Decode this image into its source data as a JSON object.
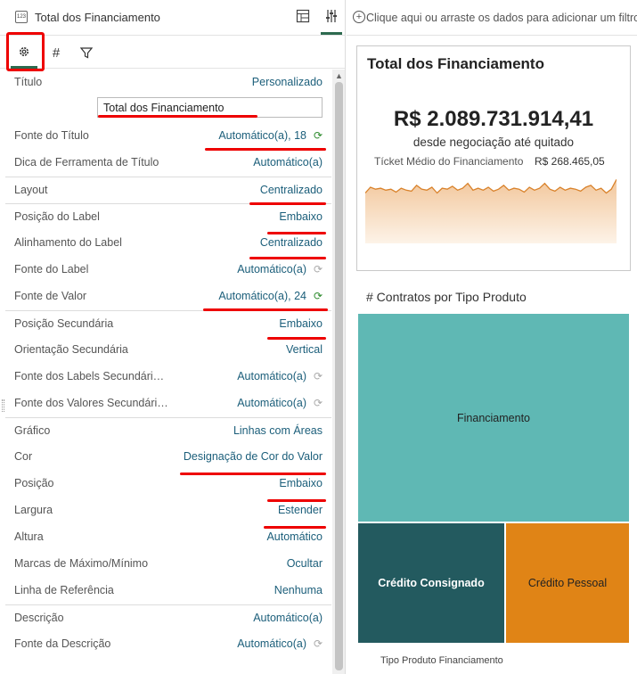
{
  "panel": {
    "title": "Total dos Financiamento",
    "viz_icon_text": "123",
    "tabs": {
      "general": "⚙",
      "values": "#",
      "filter": "⛛"
    }
  },
  "properties": [
    {
      "label": "Título",
      "value": "Personalizado"
    },
    {
      "label": "Fonte do Título",
      "value": "Automático(a), 18"
    },
    {
      "label": "Dica de Ferramenta de Título",
      "value": "Automático(a)"
    },
    {
      "label": "Layout",
      "value": "Centralizado"
    },
    {
      "label": "Posição do Label",
      "value": "Embaixo"
    },
    {
      "label": "Alinhamento do Label",
      "value": "Centralizado"
    },
    {
      "label": "Fonte do Label",
      "value": "Automático(a)"
    },
    {
      "label": "Fonte de Valor",
      "value": "Automático(a), 24"
    },
    {
      "label": "Posição Secundária",
      "value": "Embaixo"
    },
    {
      "label": "Orientação Secundária",
      "value": "Vertical"
    },
    {
      "label": "Fonte dos Labels Secundári…",
      "value": "Automático(a)"
    },
    {
      "label": "Fonte dos Valores Secundári…",
      "value": "Automático(a)"
    },
    {
      "label": "Gráfico",
      "value": "Linhas com Áreas"
    },
    {
      "label": "Cor",
      "value": "Designação de Cor do Valor"
    },
    {
      "label": "Posição",
      "value": "Embaixo"
    },
    {
      "label": "Largura",
      "value": "Estender"
    },
    {
      "label": "Altura",
      "value": "Automático"
    },
    {
      "label": "Marcas de Máximo/Mínimo",
      "value": "Ocultar"
    },
    {
      "label": "Linha de Referência",
      "value": "Nenhuma"
    },
    {
      "label": "Descrição",
      "value": "Automático(a)"
    },
    {
      "label": "Fonte da Descrição",
      "value": "Automático(a)"
    }
  ],
  "title_input_value": "Total dos Financiamento",
  "filter_bar": {
    "text": "Clique aqui ou arraste os dados para adicionar um filtro"
  },
  "tile": {
    "title": "Total dos Financiamento",
    "value": "R$ 2.089.731.914,41",
    "subtitle": "desde negociação até quitado",
    "secondary_label": "Tícket Médio do Financiamento",
    "secondary_value": "R$ 268.465,05",
    "sparkline": [
      52,
      58,
      56,
      57,
      55,
      56,
      53,
      57,
      55,
      54,
      60,
      56,
      55,
      58,
      52,
      57,
      56,
      59,
      55,
      57,
      62,
      55,
      57,
      55,
      58,
      54,
      56,
      60,
      55,
      57,
      56,
      53,
      58,
      55,
      57,
      62,
      56,
      54,
      58,
      55,
      57,
      56,
      54,
      58,
      60,
      55,
      57,
      52,
      56,
      66
    ],
    "spark_color": "#d9822b"
  },
  "treemap": {
    "title": "# Contratos por Tipo Produto",
    "axis_label": "Tipo Produto Financiamento",
    "cells": {
      "financiamento": "Financiamento",
      "consignado": "Crédito Consignado",
      "pessoal": "Crédito Pessoal"
    },
    "colors": {
      "financiamento": "#5fb8b4",
      "consignado": "#235a5f",
      "pessoal": "#e08416"
    }
  },
  "colors": {
    "accent": "#2d6a4f",
    "annotation_red": "#ee0000",
    "link_value": "#1b5e7a"
  }
}
